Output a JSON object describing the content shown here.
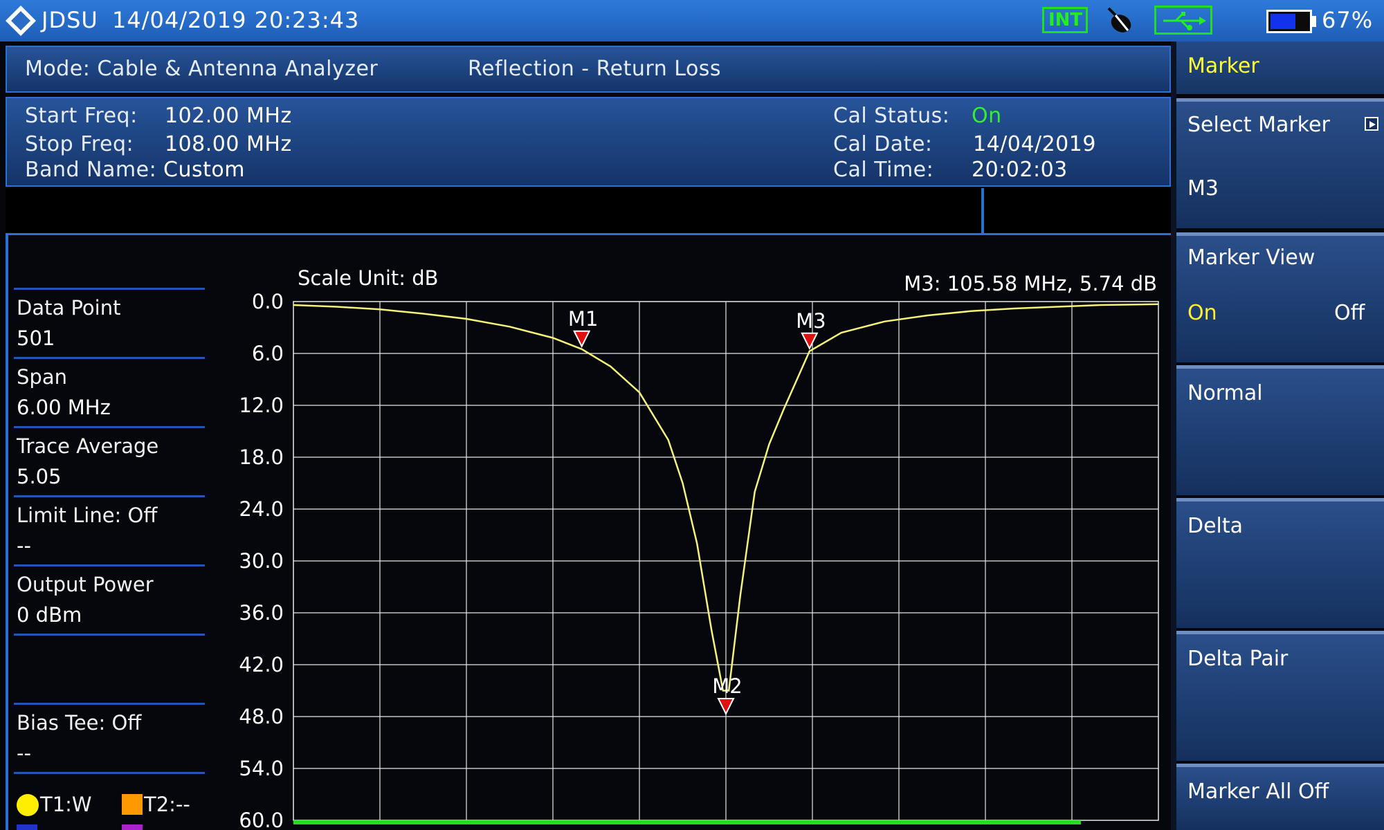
{
  "status_bar": {
    "brand": "JDSU",
    "datetime": "14/04/2019 20:23:43",
    "int_badge": "INT",
    "battery_percent": "67%",
    "battery_level": 0.67,
    "icons": [
      "jdsu-diamond-logo",
      "int-badge",
      "satellite-icon",
      "usb-icon",
      "battery-icon"
    ]
  },
  "mode_bar": {
    "mode": "Mode: Cable & Antenna Analyzer",
    "measurement": "Reflection - Return Loss"
  },
  "settings": {
    "start_freq_label": "Start Freq:",
    "start_freq_value": "102.00 MHz",
    "stop_freq_label": "Stop Freq:",
    "stop_freq_value": "108.00 MHz",
    "band_name_label": "Band Name:",
    "band_name_value": "Custom",
    "cal_status_label": "Cal Status:",
    "cal_status_value": "On",
    "cal_date_label": "Cal Date:",
    "cal_date_value": "14/04/2019",
    "cal_time_label": "Cal Time:",
    "cal_time_value": "20:02:03"
  },
  "left_info": {
    "data_point_label": "Data Point",
    "data_point_value": "501",
    "span_label": "Span",
    "span_value": "6.00 MHz",
    "trace_average_label": "Trace Average",
    "trace_average_value": "5.05",
    "limit_line_label": "Limit Line: Off",
    "limit_line_value": "--",
    "output_power_label": "Output Power",
    "output_power_value": "0 dBm",
    "bias_tee_label": "Bias Tee: Off",
    "bias_tee_value": "--",
    "trace1": "T1:W",
    "trace2": "T2:--"
  },
  "chart_header": {
    "scale_unit": "Scale Unit: dB",
    "marker_readout": "M3: 105.58 MHz, 5.74 dB"
  },
  "colors": {
    "trace": "#f4f27a",
    "marker": "#e01010",
    "softkey_title": "#ffff33",
    "cal_on": "#33ee33",
    "trace1_dot": "#ffee00",
    "trace2_dot": "#ff9900"
  },
  "softkeys": {
    "title": "Marker",
    "select_marker_label": "Select Marker",
    "select_marker_value": "M3",
    "marker_view_label": "Marker View",
    "marker_view_on": "On",
    "marker_view_off": "Off",
    "normal": "Normal",
    "delta": "Delta",
    "delta_pair": "Delta Pair",
    "marker_all_off": "Marker All Off"
  },
  "chart_data": {
    "type": "line",
    "xlim": [
      102.0,
      108.0
    ],
    "ylim": [
      0.0,
      60.0
    ],
    "y_inverted": true,
    "grid": true,
    "y_ticks": [
      "0.0",
      "6.0",
      "12.0",
      "18.0",
      "24.0",
      "30.0",
      "36.0",
      "42.0",
      "48.0",
      "54.0",
      "60.0"
    ],
    "series": [
      {
        "x": [
          102.0,
          102.3,
          102.6,
          102.9,
          103.2,
          103.5,
          103.8,
          104.0,
          104.2,
          104.4,
          104.6,
          104.7,
          104.8,
          104.9,
          104.98,
          105.02,
          105.1,
          105.2,
          105.3,
          105.4,
          105.58,
          105.8,
          106.1,
          106.4,
          106.7,
          107.0,
          107.3,
          107.6,
          108.0
        ],
        "y": [
          0.4,
          0.6,
          0.9,
          1.4,
          2.0,
          2.9,
          4.2,
          5.5,
          7.5,
          10.5,
          16.0,
          21.0,
          28.0,
          38.0,
          45.0,
          45.0,
          34.0,
          22.0,
          16.5,
          12.5,
          5.74,
          3.6,
          2.3,
          1.6,
          1.1,
          0.8,
          0.6,
          0.4,
          0.3
        ]
      }
    ],
    "markers": [
      {
        "label": "M1",
        "x": 104.0,
        "y": 5.5
      },
      {
        "label": "M2",
        "x": 105.0,
        "y": 48.0
      },
      {
        "label": "M3",
        "x": 105.58,
        "y": 5.74
      }
    ]
  }
}
